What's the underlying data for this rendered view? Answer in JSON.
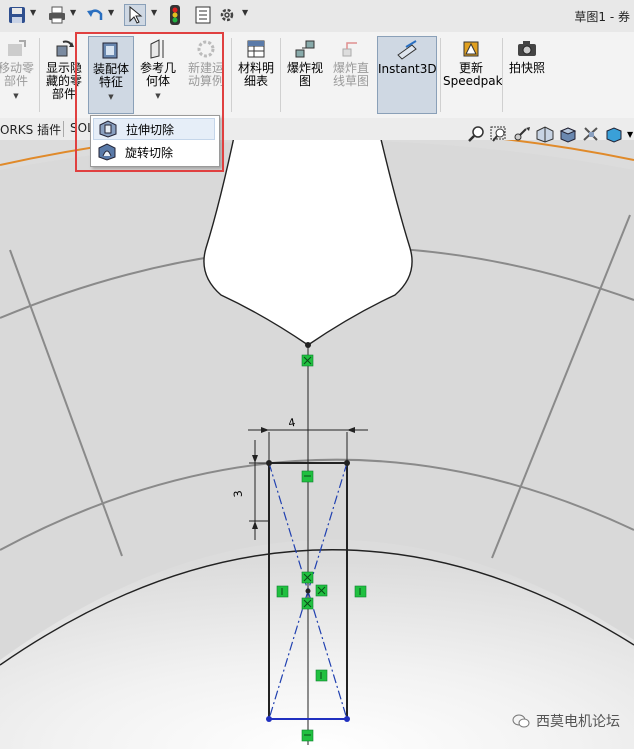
{
  "window": {
    "doc_title": "草图1 - 券"
  },
  "ribbon": {
    "move_component": "移动零\n部件",
    "show_hidden": "显示隐\n藏的零\n部件",
    "assembly_feature": "装配体\n特征",
    "reference_geometry": "参考几\n何体",
    "new_motion_study": "新建运\n动算例",
    "bom": "材料明\n细表",
    "exploded_view": "爆炸视\n图",
    "explode_line_sketch": "爆炸直\n线草图",
    "instant3d": "Instant3D",
    "update_speedpak": "更新\nSpeedpak",
    "snapshot": "拍快照"
  },
  "tabs": {
    "addins": "ORKS 插件",
    "solid": "SOL"
  },
  "dropdown": {
    "extrude_cut": "拉伸切除",
    "revolve_cut": "旋转切除"
  },
  "sketch": {
    "dim_width": "4",
    "dim_height": "3"
  },
  "watermark": {
    "text": "西莫电机论坛"
  },
  "colors": {
    "highlight_box": "#e04040",
    "sketch_constraint": "#20c040",
    "arc_edge": "#e08a2a"
  }
}
